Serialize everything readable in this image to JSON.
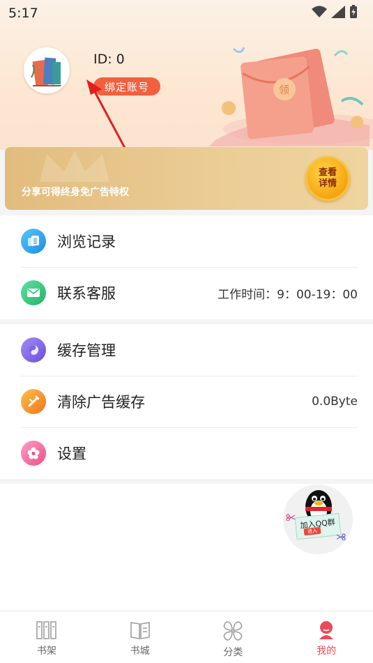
{
  "status_bar": {
    "time": "5:17"
  },
  "profile": {
    "id_label": "ID: 0",
    "bind_label": "绑定账号"
  },
  "banner": {
    "text": "分享可得终身免广告特权",
    "button_label": "查看\n详情"
  },
  "menu_group_1": [
    {
      "label": "浏览记录",
      "value": "",
      "icon": "history-icon",
      "color": "#2aa5ef"
    },
    {
      "label": "联系客服",
      "value": "工作时间：9：00-19：00",
      "icon": "mail-icon",
      "color": "#35c87a"
    }
  ],
  "menu_group_2": [
    {
      "label": "缓存管理",
      "value": "",
      "icon": "cache-icon",
      "color": "#7f66e8"
    },
    {
      "label": "清除广告缓存",
      "value": "0.0Byte",
      "icon": "clear-icon",
      "color": "#f39a2a"
    },
    {
      "label": "设置",
      "value": "",
      "icon": "settings-icon",
      "color": "#f06da0"
    }
  ],
  "qq_float": {
    "tag": "加入QQ群",
    "enter": "进入"
  },
  "bottom_nav": [
    {
      "label": "书架",
      "icon": "bookshelf-icon",
      "active": false
    },
    {
      "label": "书城",
      "icon": "bookstore-icon",
      "active": false
    },
    {
      "label": "分类",
      "icon": "category-icon",
      "active": false
    },
    {
      "label": "我的",
      "icon": "profile-icon",
      "active": true
    }
  ],
  "colors": {
    "accent": "#f2603e",
    "nav_active": "#e94b5a",
    "banner_gold": "#e2bc7e"
  }
}
